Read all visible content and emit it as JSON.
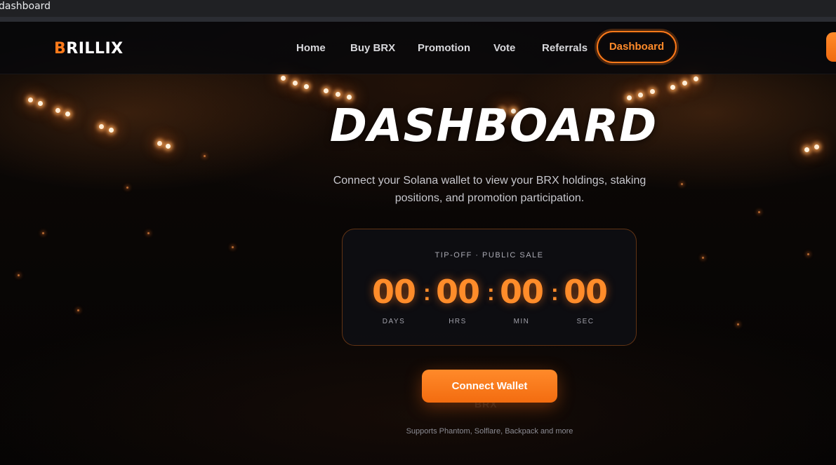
{
  "browser": {
    "tab_title": "dashboard"
  },
  "brand": {
    "logo_initial": "B",
    "logo_rest": "RILLIX"
  },
  "nav": {
    "items": [
      {
        "label": "Home"
      },
      {
        "label": "Buy BRX"
      },
      {
        "label": "Promotion"
      },
      {
        "label": "Vote"
      },
      {
        "label": "Referrals"
      },
      {
        "label": "Dashboard",
        "active": true
      }
    ]
  },
  "hero": {
    "title": "DASHBOARD",
    "subtitle": "Connect your Solana wallet to view your BRX holdings, staking positions, and promotion participation."
  },
  "countdown": {
    "label": "TIP-OFF · PUBLIC SALE",
    "days": "00",
    "hours": "00",
    "minutes": "00",
    "seconds": "00",
    "units": {
      "days": "DAYS",
      "hours": "HRS",
      "minutes": "MIN",
      "seconds": "SEC"
    }
  },
  "wallet": {
    "connect_label": "Connect Wallet",
    "watermark": "BRX",
    "supports": "Supports Phantom, Solflare, Backpack and more"
  },
  "colors": {
    "accent": "#ff7a1a",
    "background": "#07070a"
  }
}
